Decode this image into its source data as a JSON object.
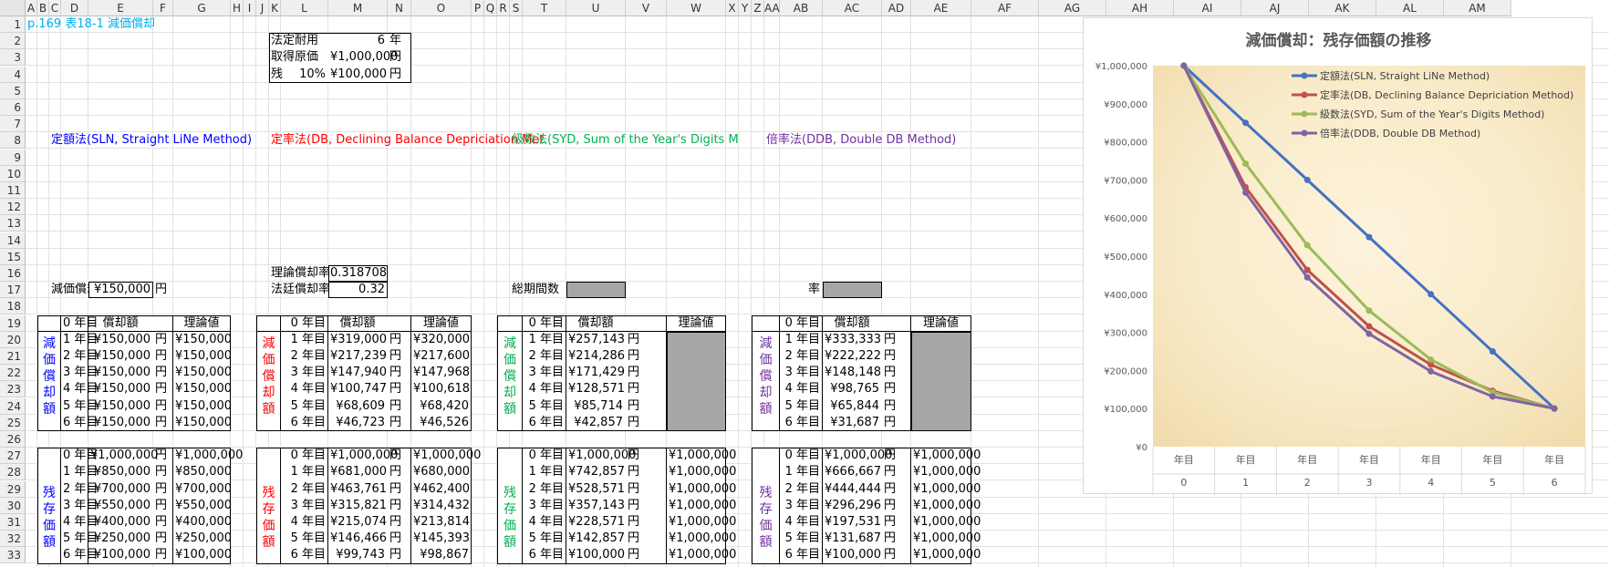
{
  "columns": [
    "A",
    "B",
    "C",
    "D",
    "E",
    "F",
    "G",
    "H",
    "I",
    "J",
    "K",
    "L",
    "M",
    "N",
    "O",
    "P",
    "Q",
    "R",
    "S",
    "T",
    "U",
    "V",
    "W",
    "X",
    "Y",
    "Z",
    "AA",
    "AB",
    "AC",
    "AD",
    "AE",
    "AF",
    "AG",
    "AH",
    "AI",
    "AJ",
    "AK",
    "AL",
    "AM"
  ],
  "rows": [
    "1",
    "2",
    "3",
    "4",
    "5",
    "6",
    "7",
    "8",
    "9",
    "10",
    "11",
    "12",
    "13",
    "14",
    "15",
    "16",
    "17",
    "18",
    "19",
    "20",
    "21",
    "22",
    "23",
    "24",
    "25",
    "26",
    "27",
    "28",
    "29",
    "30",
    "31",
    "32",
    "33"
  ],
  "header": {
    "title": "p.169 表18-1 減価償却"
  },
  "params": {
    "life_label": "法定耐用",
    "life_value": "6",
    "life_unit": "年",
    "cost_label": "取得原価",
    "cost_value": "¥1,000,000",
    "cost_unit": "円",
    "residual_label": "残",
    "residual_pct": "10%",
    "residual_value": "¥100,000",
    "residual_unit": "円"
  },
  "section_titles": {
    "sln": "定額法(SLN, Straight LiNe Method)",
    "db": "定率法(DB, Declining Balance Depriciation Met",
    "syd": "級数法(SYD, Sum of the Year's Digits M",
    "ddb": "倍率法(DDB, Double DB Method)"
  },
  "inputs": {
    "sln_label": "減価償却額",
    "sln_value": "¥150,000",
    "sln_unit": "円",
    "db_theory_label": "理論償却率",
    "db_theory_value": "0.318708",
    "db_legal_label": "法廷償却率",
    "db_legal_value": "0.32",
    "syd_label": "総期間数",
    "syd_value": "",
    "ddb_label": "率",
    "ddb_value": ""
  },
  "table_headers": {
    "year": "0 年目",
    "amount": "償却額",
    "theory": "理論値"
  },
  "years": [
    "0 年目",
    "1 年目",
    "2 年目",
    "3 年目",
    "4 年目",
    "5 年目",
    "6 年目"
  ],
  "side_labels": {
    "dep": "減価償却額",
    "rem": "残存価額"
  },
  "unit": "円",
  "sln": {
    "dep": [
      "¥150,000",
      "¥150,000",
      "¥150,000",
      "¥150,000",
      "¥150,000",
      "¥150,000"
    ],
    "dep_theory": [
      "¥150,000",
      "¥150,000",
      "¥150,000",
      "¥150,000",
      "¥150,000",
      "¥150,000"
    ],
    "rem": [
      "¥1,000,000",
      "¥850,000",
      "¥700,000",
      "¥550,000",
      "¥400,000",
      "¥250,000",
      "¥100,000"
    ],
    "rem_theory": [
      "¥1,000,000",
      "¥850,000",
      "¥700,000",
      "¥550,000",
      "¥400,000",
      "¥250,000",
      "¥100,000"
    ]
  },
  "db": {
    "dep": [
      "¥319,000",
      "¥217,239",
      "¥147,940",
      "¥100,747",
      "¥68,609",
      "¥46,723"
    ],
    "dep_theory": [
      "¥320,000",
      "¥217,600",
      "¥147,968",
      "¥100,618",
      "¥68,420",
      "¥46,526"
    ],
    "rem": [
      "¥1,000,000",
      "¥681,000",
      "¥463,761",
      "¥315,821",
      "¥215,074",
      "¥146,466",
      "¥99,743"
    ],
    "rem_theory": [
      "¥1,000,000",
      "¥680,000",
      "¥462,400",
      "¥314,432",
      "¥213,814",
      "¥145,393",
      "¥98,867"
    ]
  },
  "syd": {
    "dep": [
      "¥257,143",
      "¥214,286",
      "¥171,429",
      "¥128,571",
      "¥85,714",
      "¥42,857"
    ],
    "rem": [
      "¥1,000,000",
      "¥742,857",
      "¥528,571",
      "¥357,143",
      "¥228,571",
      "¥142,857",
      "¥100,000"
    ],
    "rem_theory": [
      "¥1,000,000",
      "¥1,000,000",
      "¥1,000,000",
      "¥1,000,000",
      "¥1,000,000",
      "¥1,000,000",
      "¥1,000,000"
    ]
  },
  "ddb": {
    "dep": [
      "¥333,333",
      "¥222,222",
      "¥148,148",
      "¥98,765",
      "¥65,844",
      "¥31,687"
    ],
    "rem": [
      "¥1,000,000",
      "¥666,667",
      "¥444,444",
      "¥296,296",
      "¥197,531",
      "¥131,687",
      "¥100,000"
    ],
    "rem_theory": [
      "¥1,000,000",
      "¥1,000,000",
      "¥1,000,000",
      "¥1,000,000",
      "¥1,000,000",
      "¥1,000,000",
      "¥1,000,000"
    ]
  },
  "colors": {
    "blue": "#0000ff",
    "red": "#ff0000",
    "green": "#00b050",
    "purple": "#7030a0",
    "cyan": "#00b0f0"
  },
  "chart_data": {
    "type": "line",
    "title": "減価償却：残存価額の推移",
    "categories": [
      "年目 0",
      "年目 1",
      "年目 2",
      "年目 3",
      "年目 4",
      "年目 5",
      "年目 6"
    ],
    "cat_line1": "年目",
    "cat_line2": [
      "0",
      "1",
      "2",
      "3",
      "4",
      "5",
      "6"
    ],
    "y_ticks": [
      "¥0",
      "¥100,000",
      "¥200,000",
      "¥300,000",
      "¥400,000",
      "¥500,000",
      "¥600,000",
      "¥700,000",
      "¥800,000",
      "¥900,000",
      "¥1,000,000"
    ],
    "ylim": [
      0,
      1000000
    ],
    "legend_position": "top-right",
    "series": [
      {
        "name": "定額法(SLN, Straight LiNe Method)",
        "color": "#4472c4",
        "values": [
          1000000,
          850000,
          700000,
          550000,
          400000,
          250000,
          100000
        ]
      },
      {
        "name": "定率法(DB, Declining Balance Depriciation Method)",
        "color": "#c0504d",
        "values": [
          1000000,
          681000,
          463761,
          315821,
          215074,
          146466,
          99743
        ]
      },
      {
        "name": "級数法(SYD, Sum of the Year's Digits Method)",
        "color": "#9bbb59",
        "values": [
          1000000,
          742857,
          528571,
          357143,
          228571,
          142857,
          100000
        ]
      },
      {
        "name": "倍率法(DDB, Double DB Method)",
        "color": "#8064a2",
        "values": [
          1000000,
          666667,
          444444,
          296296,
          197531,
          131687,
          100000
        ]
      }
    ]
  }
}
